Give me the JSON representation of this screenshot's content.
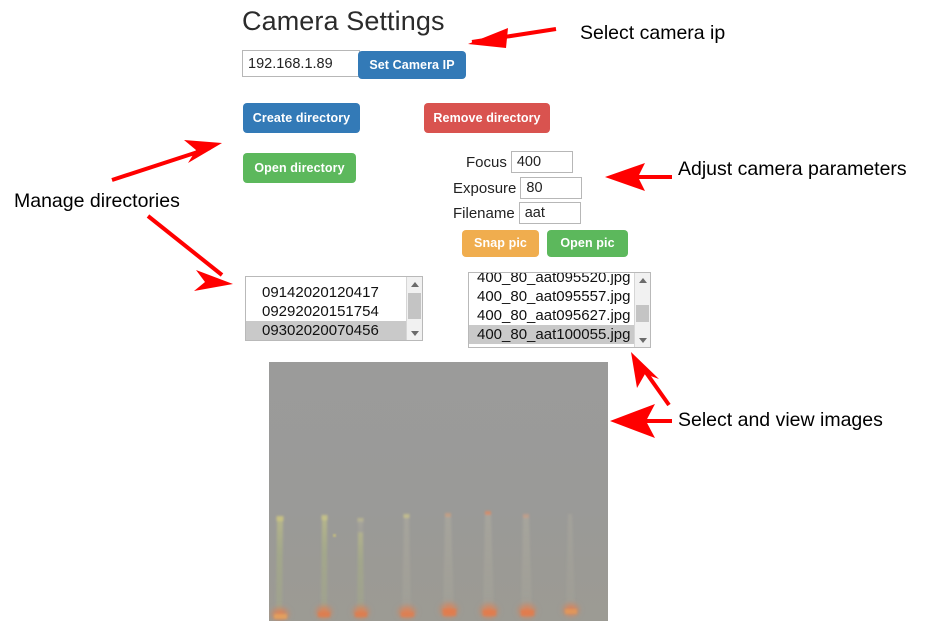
{
  "app": {
    "title": "Camera Settings",
    "camera_ip": {
      "value": "192.168.1.89",
      "placeholder": "Camera IP",
      "set_button": "Set Camera IP"
    },
    "directory_buttons": {
      "create": "Create directory",
      "remove": "Remove directory",
      "open": "Open directory"
    },
    "parameters": [
      {
        "label": "Focus",
        "value": "400"
      },
      {
        "label": "Exposure",
        "value": "80"
      },
      {
        "label": "Filename",
        "value": "aat"
      }
    ],
    "picture_buttons": {
      "snap": "Snap pic",
      "open": "Open pic"
    },
    "directory_list": {
      "items": [
        {
          "text": "09142020120417",
          "selected": false
        },
        {
          "text": "09292020151754",
          "selected": false
        },
        {
          "text": "09302020070456",
          "selected": true
        }
      ]
    },
    "file_list": {
      "items": [
        {
          "text": "400_80_aat095520.jpg",
          "selected": false
        },
        {
          "text": "400_80_aat095557.jpg",
          "selected": false
        },
        {
          "text": "400_80_aat095627.jpg",
          "selected": false
        },
        {
          "text": "400_80_aat100055.jpg",
          "selected": true
        }
      ]
    },
    "photo": {
      "description": "Foggy grey sky with eight faint vertical towers having orange-red glowing bases"
    }
  },
  "annotations": {
    "select_camera_ip": "Select camera ip",
    "adjust_camera_parameters": "Adjust camera parameters",
    "manage_directories": "Manage directories",
    "select_and_view_images": "Select and view images",
    "arrow_color": "#FF0000"
  },
  "colors": {
    "primary": "#337ab7",
    "danger": "#d9534f",
    "success": "#5cb85c",
    "warning": "#f0ad4e",
    "selection": "#c9c9c9",
    "annotation": "#ff0000"
  }
}
